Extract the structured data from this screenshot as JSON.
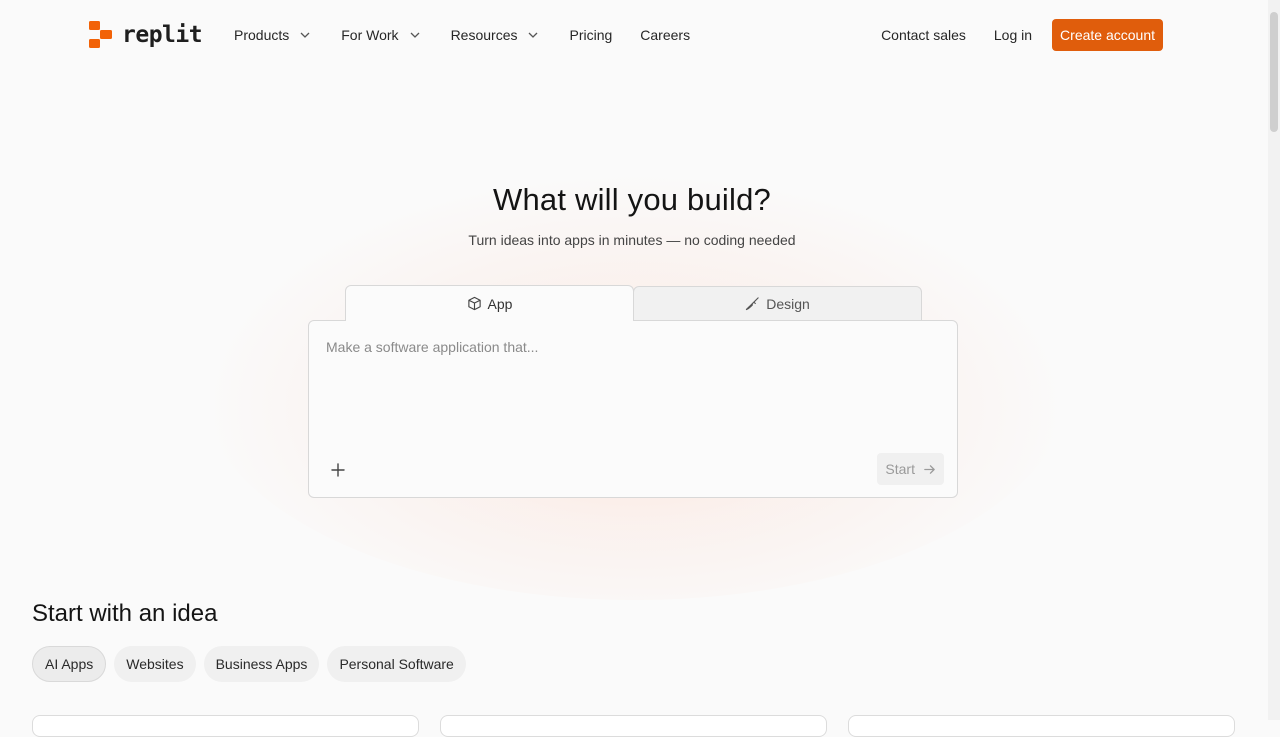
{
  "header": {
    "logo_text": "replit",
    "nav": [
      {
        "label": "Products",
        "has_dropdown": true
      },
      {
        "label": "For Work",
        "has_dropdown": true
      },
      {
        "label": "Resources",
        "has_dropdown": true
      },
      {
        "label": "Pricing",
        "has_dropdown": false
      },
      {
        "label": "Careers",
        "has_dropdown": false
      }
    ],
    "contact_sales": "Contact sales",
    "log_in": "Log in",
    "create_account": "Create account"
  },
  "hero": {
    "title": "What will you build?",
    "subtitle": "Turn ideas into apps in minutes — no coding needed",
    "tabs": [
      {
        "label": "App",
        "icon": "cube-icon",
        "active": true
      },
      {
        "label": "Design",
        "icon": "brush-icon",
        "active": false
      }
    ],
    "prompt_placeholder": "Make a software application that...",
    "start_label": "Start"
  },
  "ideas": {
    "title": "Start with an idea",
    "chips": [
      {
        "label": "AI Apps",
        "active": true
      },
      {
        "label": "Websites",
        "active": false
      },
      {
        "label": "Business Apps",
        "active": false
      },
      {
        "label": "Personal Software",
        "active": false
      }
    ]
  },
  "colors": {
    "brand": "#f26207",
    "cta": "#e05d0c",
    "background": "#fafafa"
  }
}
